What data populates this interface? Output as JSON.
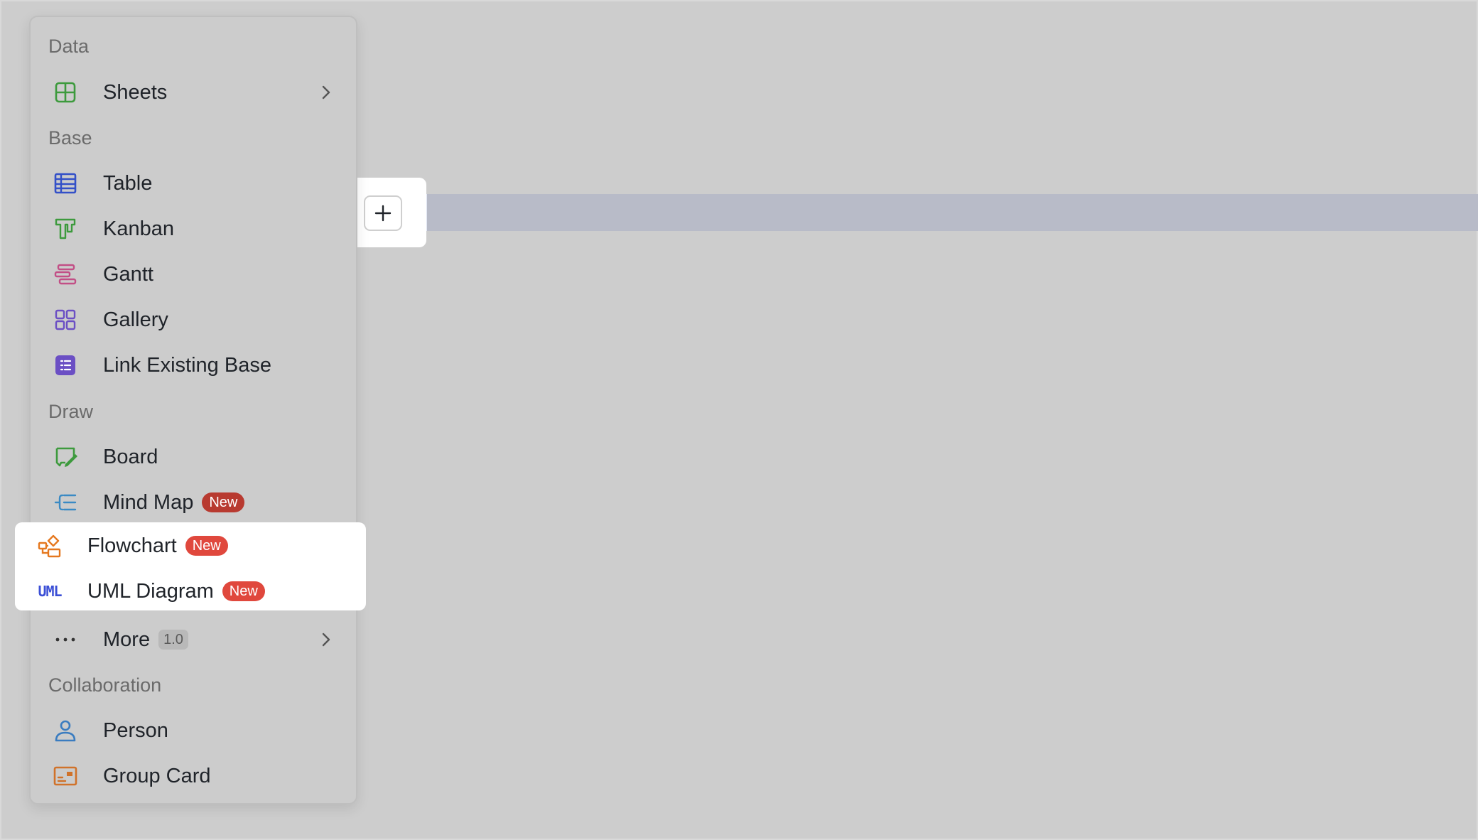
{
  "menu": {
    "sections": {
      "data": "Data",
      "base": "Base",
      "draw": "Draw",
      "collaboration": "Collaboration"
    },
    "items": {
      "sheets": "Sheets",
      "table": "Table",
      "kanban": "Kanban",
      "gantt": "Gantt",
      "gallery": "Gallery",
      "link_existing_base": "Link Existing Base",
      "board": "Board",
      "mind_map": "Mind Map",
      "flowchart": "Flowchart",
      "uml_diagram": "UML Diagram",
      "more": "More",
      "person": "Person",
      "group_card": "Group Card"
    },
    "badges": {
      "new": "New",
      "more_version": "1.0"
    },
    "uml_icon_text": "UML"
  },
  "colors": {
    "green": "#3d9a3d",
    "blue": "#3350c8",
    "pink": "#c24f86",
    "purple": "#6b4fc4",
    "teal": "#3a8ac4",
    "orange": "#e5781f",
    "uml": "#3b4fd6",
    "person": "#3a7cc0",
    "group": "#d0722a",
    "badge_new": "#e0483d"
  }
}
